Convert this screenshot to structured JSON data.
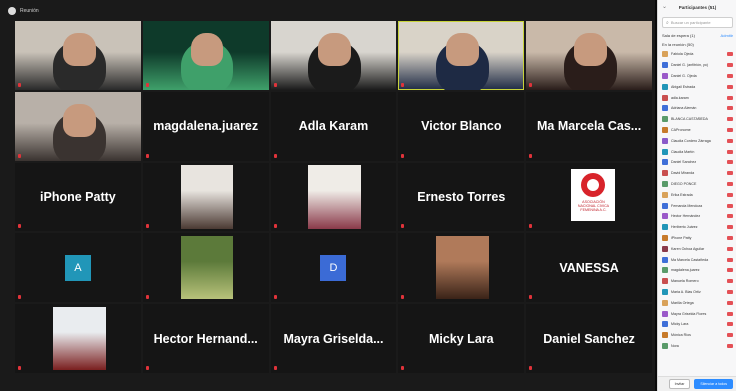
{
  "window": {
    "title": "Reunión"
  },
  "tiles": [
    {
      "name": "",
      "label": "",
      "type": "video",
      "speaking": false,
      "colors": [
        "#c9c2b8",
        "#2a2a2a"
      ]
    },
    {
      "name": "",
      "label": "",
      "type": "video",
      "speaking": false,
      "colors": [
        "#0e3a2a",
        "#3fa06a"
      ]
    },
    {
      "name": "",
      "label": "",
      "type": "video",
      "speaking": false,
      "colors": [
        "#d8d5cf",
        "#1b1b1b"
      ]
    },
    {
      "name": "",
      "label": "",
      "type": "video",
      "speaking": true,
      "colors": [
        "#d9d3c8",
        "#1e2a44"
      ]
    },
    {
      "name": "",
      "label": "",
      "type": "video",
      "speaking": false,
      "colors": [
        "#c9b9a9",
        "#2a1d1a"
      ]
    },
    {
      "name": "",
      "label": "",
      "type": "video",
      "speaking": false,
      "colors": [
        "#b8b0a8",
        "#3a3330"
      ]
    },
    {
      "name": "magdalena.juarez",
      "label": "",
      "type": "name",
      "speaking": false
    },
    {
      "name": "Adla Karam",
      "label": "",
      "type": "name",
      "speaking": false
    },
    {
      "name": "Victor Blanco",
      "label": "",
      "type": "name",
      "speaking": false
    },
    {
      "name": "Ma Marcela Cas...",
      "label": "",
      "type": "name",
      "speaking": false
    },
    {
      "name": "iPhone Patty",
      "label": "",
      "type": "name",
      "speaking": false
    },
    {
      "name": "",
      "label": "",
      "type": "photo",
      "speaking": false,
      "colors": [
        "#e8e4df",
        "#4b3a33"
      ]
    },
    {
      "name": "",
      "label": "",
      "type": "photo",
      "speaking": false,
      "colors": [
        "#efece7",
        "#8a3a4a"
      ]
    },
    {
      "name": "Ernesto Torres",
      "label": "",
      "type": "name",
      "speaking": false
    },
    {
      "name": "",
      "label": "",
      "type": "logo",
      "speaking": false,
      "logo_text": "ASOCIACIÓN NACIONAL CIVICA FEMENINA A.C."
    },
    {
      "name": "",
      "label": "",
      "type": "avatar",
      "speaking": false,
      "letter": "A",
      "color": "#2196b8"
    },
    {
      "name": "",
      "label": "",
      "type": "photo",
      "speaking": false,
      "colors": [
        "#5c7a3a",
        "#b8c27a"
      ]
    },
    {
      "name": "",
      "label": "",
      "type": "avatar",
      "speaking": false,
      "letter": "D",
      "color": "#3b6bd6"
    },
    {
      "name": "",
      "label": "",
      "type": "photo",
      "speaking": false,
      "colors": [
        "#b07a5a",
        "#3a2318"
      ]
    },
    {
      "name": "VANESSA",
      "label": "",
      "type": "name",
      "speaking": false
    },
    {
      "name": "",
      "label": "",
      "type": "photo",
      "speaking": false,
      "colors": [
        "#e9ecef",
        "#7a1f1f"
      ]
    },
    {
      "name": "Hector  Hernand...",
      "label": "",
      "type": "name",
      "speaking": false
    },
    {
      "name": "Mayra  Griselda...",
      "label": "",
      "type": "name",
      "speaking": false
    },
    {
      "name": "Micky Lara",
      "label": "",
      "type": "name",
      "speaking": false
    },
    {
      "name": "Daniel Sanchez",
      "label": "",
      "type": "name",
      "speaking": false
    }
  ],
  "panel": {
    "title": "Participantes (51)",
    "search_placeholder": "Buscar un participante",
    "waiting_section": "Sala de espera (1)",
    "waiting_action": "Admitir",
    "meeting_section": "En la reunión (50)",
    "participants": [
      {
        "name": "Fabiola Ojeda",
        "color": "#d9a25a"
      },
      {
        "name": "Daniel G. (anfitrión, yo)",
        "color": "#3f6fd8"
      },
      {
        "name": "Daniel G. Ojeda",
        "color": "#9b5ac9"
      },
      {
        "name": "Abigail Estrada",
        "color": "#2196b8"
      },
      {
        "name": "adla.karam",
        "color": "#c94f4f"
      },
      {
        "name": "Adriana Alemán",
        "color": "#3f6fd8"
      },
      {
        "name": "BLANCA CASTAÑEDA",
        "color": "#5a9b6a"
      },
      {
        "name": "CAPronome",
        "color": "#c77a2a"
      },
      {
        "name": "Claudia Cordero Zárraga",
        "color": "#8a5ac9"
      },
      {
        "name": "Claudia Martín",
        "color": "#2196b8"
      },
      {
        "name": "Daniel Sanchez",
        "color": "#3f6fd8"
      },
      {
        "name": "David Miranda",
        "color": "#c94f4f"
      },
      {
        "name": "DIEGO PONCE",
        "color": "#5a9b6a"
      },
      {
        "name": "Erika Estrada",
        "color": "#d9a25a"
      },
      {
        "name": "Fernanda Mendoza",
        "color": "#3f6fd8"
      },
      {
        "name": "Hector Hernández",
        "color": "#9b5ac9"
      },
      {
        "name": "Heriberto Juárez",
        "color": "#2196b8"
      },
      {
        "name": "iPhone Patty",
        "color": "#c77a2a"
      },
      {
        "name": "Karen Ochoa Aguilar",
        "color": "#8a3a4a"
      },
      {
        "name": "Ma Marcela Castañeda",
        "color": "#3f6fd8"
      },
      {
        "name": "magdalena.juarez",
        "color": "#5a9b6a"
      },
      {
        "name": "Manuela Romero",
        "color": "#c94f4f"
      },
      {
        "name": "Maria A. Blas Ortiz",
        "color": "#2196b8"
      },
      {
        "name": "Marilia Ortega",
        "color": "#d9a25a"
      },
      {
        "name": "Mayra Griselda Flores",
        "color": "#9b5ac9"
      },
      {
        "name": "Micky Lara",
        "color": "#3f6fd8"
      },
      {
        "name": "Mónica Ríos",
        "color": "#c77a2a"
      },
      {
        "name": "Nora",
        "color": "#5a9b6a"
      }
    ],
    "invite_label": "Invitar",
    "mute_all_label": "Silenciar a todos"
  }
}
